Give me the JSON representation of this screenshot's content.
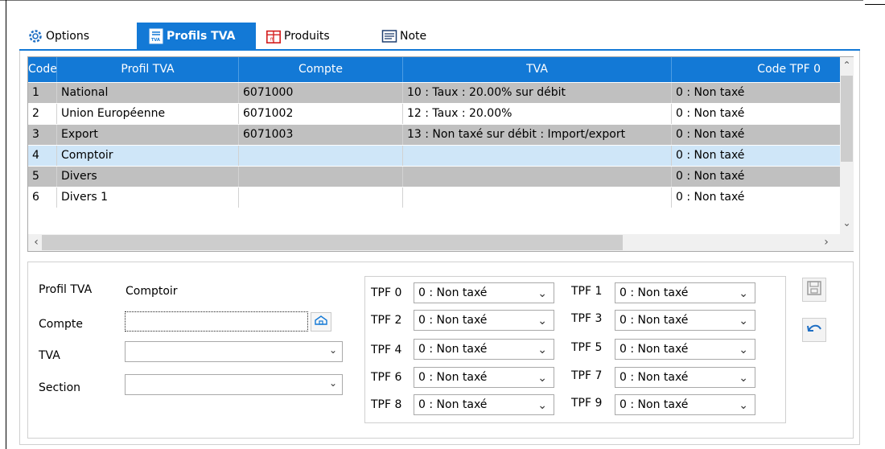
{
  "tabs": [
    {
      "label": "Options",
      "icon": "gear-icon"
    },
    {
      "label": "Profils TVA",
      "icon": "tva-document-icon"
    },
    {
      "label": "Produits",
      "icon": "product-box-icon"
    },
    {
      "label": "Note",
      "icon": "note-icon"
    }
  ],
  "active_tab": "Profils TVA",
  "grid": {
    "columns": [
      "Code",
      "Profil TVA",
      "Compte",
      "TVA",
      "Code TPF 0"
    ],
    "rows": [
      {
        "code": "1",
        "profil": "National",
        "compte": "6071000",
        "tva": "10 : Taux : 20.00% sur débit",
        "tpf0": "0 : Non taxé"
      },
      {
        "code": "2",
        "profil": "Union Européenne",
        "compte": "6071002",
        "tva": "12 : Taux : 20.00%",
        "tpf0": "0 : Non taxé"
      },
      {
        "code": "3",
        "profil": "Export",
        "compte": "6071003",
        "tva": "13 : Non taxé sur débit : Import/export",
        "tpf0": "0 : Non taxé"
      },
      {
        "code": "4",
        "profil": "Comptoir",
        "compte": "",
        "tva": "",
        "tpf0": "0 : Non taxé"
      },
      {
        "code": "5",
        "profil": "Divers",
        "compte": "",
        "tva": "",
        "tpf0": "0 : Non taxé"
      },
      {
        "code": "6",
        "profil": "Divers 1",
        "compte": "",
        "tva": "",
        "tpf0": "0 : Non taxé"
      }
    ],
    "selected_row": "4"
  },
  "detail": {
    "profil_label": "Profil TVA",
    "profil_value": "Comptoir",
    "compte_label": "Compte",
    "compte_value": "",
    "tva_label": "TVA",
    "tva_value": "",
    "section_label": "Section",
    "section_value": ""
  },
  "tpf": [
    {
      "label": "TPF 0",
      "value": "0 : Non taxé"
    },
    {
      "label": "TPF 1",
      "value": "0 : Non taxé"
    },
    {
      "label": "TPF 2",
      "value": "0 : Non taxé"
    },
    {
      "label": "TPF 3",
      "value": "0 : Non taxé"
    },
    {
      "label": "TPF 4",
      "value": "0 : Non taxé"
    },
    {
      "label": "TPF 5",
      "value": "0 : Non taxé"
    },
    {
      "label": "TPF 6",
      "value": "0 : Non taxé"
    },
    {
      "label": "TPF 7",
      "value": "0 : Non taxé"
    },
    {
      "label": "TPF 8",
      "value": "0 : Non taxé"
    },
    {
      "label": "TPF 9",
      "value": "0 : Non taxé"
    }
  ],
  "icons": {
    "save": "save-icon",
    "undo": "undo-icon",
    "lookup": "lookup-icon"
  },
  "colors": {
    "accent": "#1379d6",
    "row_gray": "#c0c0c0",
    "row_selected": "#cfe6f8"
  }
}
